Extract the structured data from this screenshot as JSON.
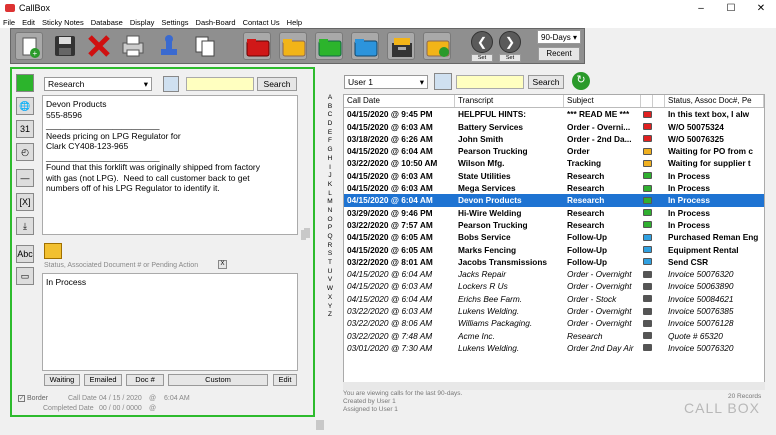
{
  "window": {
    "title": "CallBox"
  },
  "menu": [
    "File",
    "Edit",
    "Sticky Notes",
    "Database",
    "Display",
    "Settings",
    "Dash-Board",
    "Contact Us",
    "Help"
  ],
  "toolbar": {
    "set_label": "Set",
    "days_value": "90-Days",
    "recent_label": "Recent"
  },
  "left": {
    "category": "Research",
    "search_label": "Search",
    "notes": "Devon Products\n555-8596\n________________________\nNeeds pricing on LPG Regulator for\nClark CY408-123-965\n________________________\nFound that this forklift was originally shipped from factory\nwith gas (not LPG).  Need to call customer back to get\nnumbers off of his LPG Regulator to identify it.",
    "status_label": "Status, Associated Document # or Pending Action",
    "status_x": "X",
    "status_value": "In Process",
    "buttons": {
      "waiting": "Waiting",
      "emailed": "Emailed",
      "doc": "Doc #",
      "custom": "Custom",
      "edit": "Edit"
    },
    "border_label": "Border",
    "call_date_label": "Call Date",
    "call_date_value": "04 / 15 / 2020",
    "call_time_value": "6:04 AM",
    "completed_label": "Completed Date",
    "completed_value": "00 / 00 / 0000",
    "at": "@"
  },
  "right": {
    "user": "User 1",
    "search_label": "Search",
    "alphabet": [
      "A",
      "B",
      "C",
      "D",
      "E",
      "F",
      "G",
      "H",
      "I",
      "J",
      "K",
      "L",
      "M",
      "N",
      "O",
      "P",
      "Q",
      "R",
      "S",
      "T",
      "U",
      "V",
      "W",
      "X",
      "Y",
      "Z"
    ],
    "columns": [
      "Call Date",
      "Transcript",
      "Subject",
      "",
      "",
      "Status, Assoc Doc#, Pe"
    ],
    "rows": [
      {
        "date": "04/15/2020 @ 9:45 PM",
        "transcript": "HELPFUL HINTS:",
        "subject": "*** READ ME ***",
        "status": "In this text box, I alw",
        "color": "#e02020",
        "style": "bold"
      },
      {
        "date": "04/15/2020 @ 6:03 AM",
        "transcript": "Battery Services",
        "subject": "Order - Overni...",
        "status": "W/O 50075324",
        "color": "#e02020",
        "style": "bold"
      },
      {
        "date": "03/18/2020 @ 6:26 AM",
        "transcript": "John Smith",
        "subject": "Order - 2nd Da...",
        "status": "W/O 50076325",
        "color": "#e02020",
        "style": "bold"
      },
      {
        "date": "04/15/2020 @ 6:04 AM",
        "transcript": "Pearson Trucking",
        "subject": "Order",
        "status": "Waiting for PO from c",
        "color": "#f0b020",
        "style": "bold"
      },
      {
        "date": "03/22/2020 @ 10:50 AM",
        "transcript": "Wilson Mfg.",
        "subject": "Tracking",
        "status": "Waiting for  supplier t",
        "color": "#f0b020",
        "style": "bold"
      },
      {
        "date": "04/15/2020 @ 6:03 AM",
        "transcript": "State Utilities",
        "subject": "Research",
        "status": "In Process",
        "color": "#30b030",
        "style": "bold"
      },
      {
        "date": "04/15/2020 @ 6:03 AM",
        "transcript": "Mega Services",
        "subject": "Research",
        "status": "In Process",
        "color": "#30b030",
        "style": "bold"
      },
      {
        "date": "04/15/2020 @ 6:04 AM",
        "transcript": "Devon Products",
        "subject": "Research",
        "status": "In Process",
        "color": "#30b030",
        "style": "sel"
      },
      {
        "date": "03/29/2020 @ 9:46 PM",
        "transcript": "Hi-Wire Welding",
        "subject": "Research",
        "status": "In Process",
        "color": "#30b030",
        "style": "bold"
      },
      {
        "date": "03/22/2020 @ 7:57 AM",
        "transcript": "Pearson Trucking",
        "subject": "Research",
        "status": "In Process",
        "color": "#30b030",
        "style": "bold"
      },
      {
        "date": "04/15/2020 @ 6:05 AM",
        "transcript": "Bobs Service",
        "subject": "Follow-Up",
        "status": "Purchased Reman Eng",
        "color": "#30a0e0",
        "style": "bold"
      },
      {
        "date": "04/15/2020 @ 6:05 AM",
        "transcript": "Marks Fencing",
        "subject": "Follow-Up",
        "status": "Equipment Rental",
        "color": "#30a0e0",
        "style": "bold"
      },
      {
        "date": "03/22/2020 @ 8:01 AM",
        "transcript": "Jacobs Transmissions",
        "subject": "Follow-Up",
        "status": "Send CSR",
        "color": "#30a0e0",
        "style": "bold"
      },
      {
        "date": "04/15/2020 @ 6:04 AM",
        "transcript": "Jacks Repair",
        "subject": "Order - Overnight",
        "status": "Invoice 50076320",
        "color": "#555555",
        "style": "ital"
      },
      {
        "date": "04/15/2020 @ 6:03 AM",
        "transcript": "Lockers R Us",
        "subject": "Order - Overnight",
        "status": "Invoice 50063890",
        "color": "#555555",
        "style": "ital"
      },
      {
        "date": "04/15/2020 @ 6:04 AM",
        "transcript": "Erichs Bee Farm.",
        "subject": "Order - Stock",
        "status": "Invoice 50084621",
        "color": "#555555",
        "style": "ital"
      },
      {
        "date": "03/22/2020 @ 6:03 AM",
        "transcript": "Lukens Welding.",
        "subject": "Order - Overnight",
        "status": "Invoice 50076385",
        "color": "#555555",
        "style": "ital"
      },
      {
        "date": "03/22/2020 @ 8:06 AM",
        "transcript": "Williams Packaging.",
        "subject": "Order - Overnight",
        "status": "Invoice 50076128",
        "color": "#555555",
        "style": "ital"
      },
      {
        "date": "03/22/2020 @ 7:48 AM",
        "transcript": "Acme Inc.",
        "subject": "Research",
        "status": "Quote # 65320",
        "color": "#555555",
        "style": "ital"
      },
      {
        "date": "03/01/2020 @ 7:30 AM",
        "transcript": "Lukens Welding.",
        "subject": "Order 2nd Day Air",
        "status": "Invoice 50076320",
        "color": "#555555",
        "style": "ital"
      }
    ],
    "info_lines": [
      "You are viewing calls for the last 90-days.",
      "Created by User 1",
      "Assigned to User 1"
    ],
    "records": "20 Records",
    "brand": "CALL BOX"
  }
}
